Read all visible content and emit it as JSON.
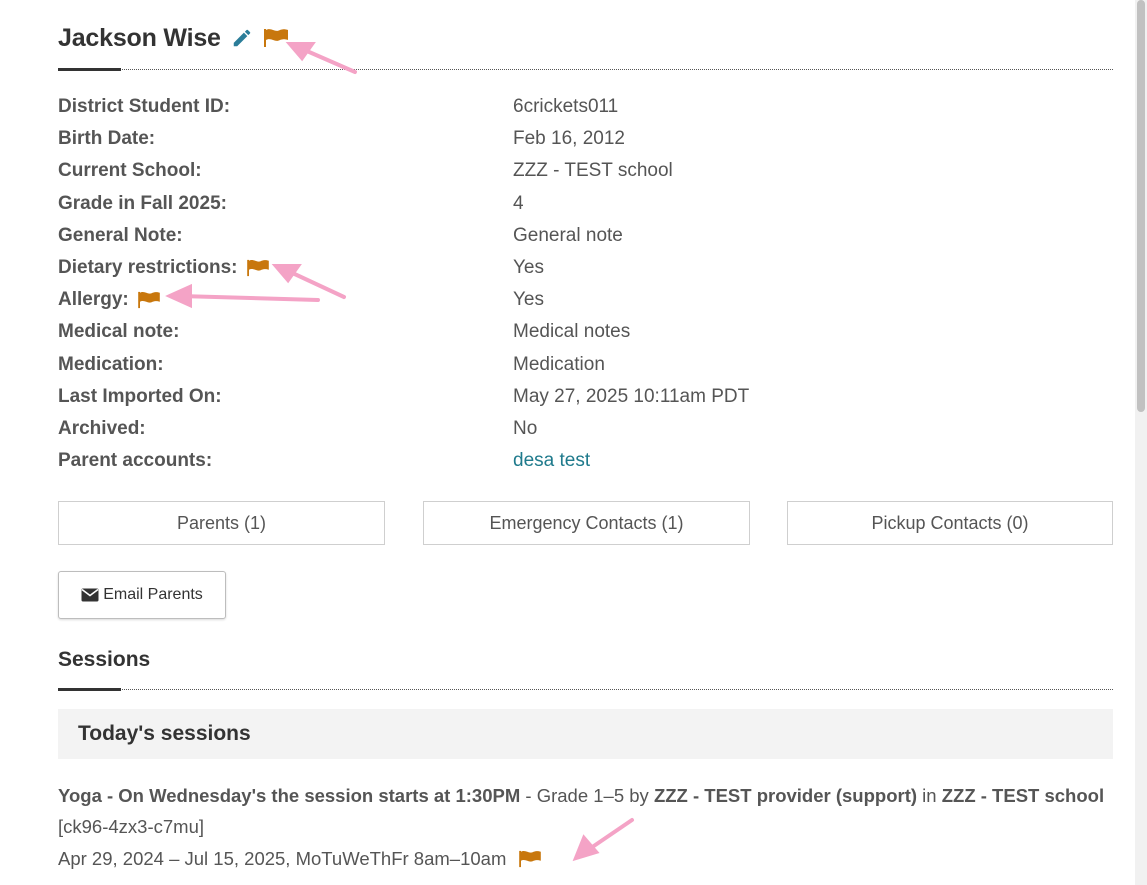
{
  "student": {
    "name": "Jackson Wise",
    "edit_icon": "pencil-icon",
    "flag_icon": "flag-icon"
  },
  "colors": {
    "flag": "#c8770d",
    "edit": "#2b7d99",
    "link": "#1f7a8c",
    "annotation_arrow": "#f4a3c6"
  },
  "details": [
    {
      "label": "District Student ID:",
      "value": "6crickets011"
    },
    {
      "label": "Birth Date:",
      "value": "Feb 16, 2012"
    },
    {
      "label": "Current School:",
      "value": "ZZZ - TEST school"
    },
    {
      "label": "Grade in Fall 2025:",
      "value": "4"
    },
    {
      "label": "General Note:",
      "value": "General note"
    },
    {
      "label": "Dietary restrictions:",
      "value": "Yes"
    },
    {
      "label": "Allergy:",
      "value": "Yes"
    },
    {
      "label": "Medical note:",
      "value": "Medical notes"
    },
    {
      "label": "Medication:",
      "value": "Medication"
    },
    {
      "label": "Last Imported On:",
      "value": "May 27, 2025 10:11am PDT"
    },
    {
      "label": "Archived:",
      "value": "No"
    },
    {
      "label": "Parent accounts:",
      "value": "desa test"
    }
  ],
  "contacts": {
    "parents": "Parents (1)",
    "emergency": "Emergency Contacts (1)",
    "pickup": "Pickup Contacts (0)"
  },
  "email_button": {
    "label": "Email Parents",
    "icon": "envelope-icon"
  },
  "sessions": {
    "title": "Sessions",
    "today_title": "Today's sessions",
    "items": [
      {
        "name": "Yoga - On Wednesday's the session starts at 1:30PM",
        "grade_text": " - Grade 1–5 by ",
        "provider": "ZZZ - TEST provider (support)",
        "in_text": " in ",
        "school": "ZZZ - TEST school",
        "code": "[ck96-4zx3-c7mu]",
        "schedule": "Apr 29, 2024 – Jul 15, 2025, MoTuWeThFr 8am–10am"
      }
    ]
  }
}
